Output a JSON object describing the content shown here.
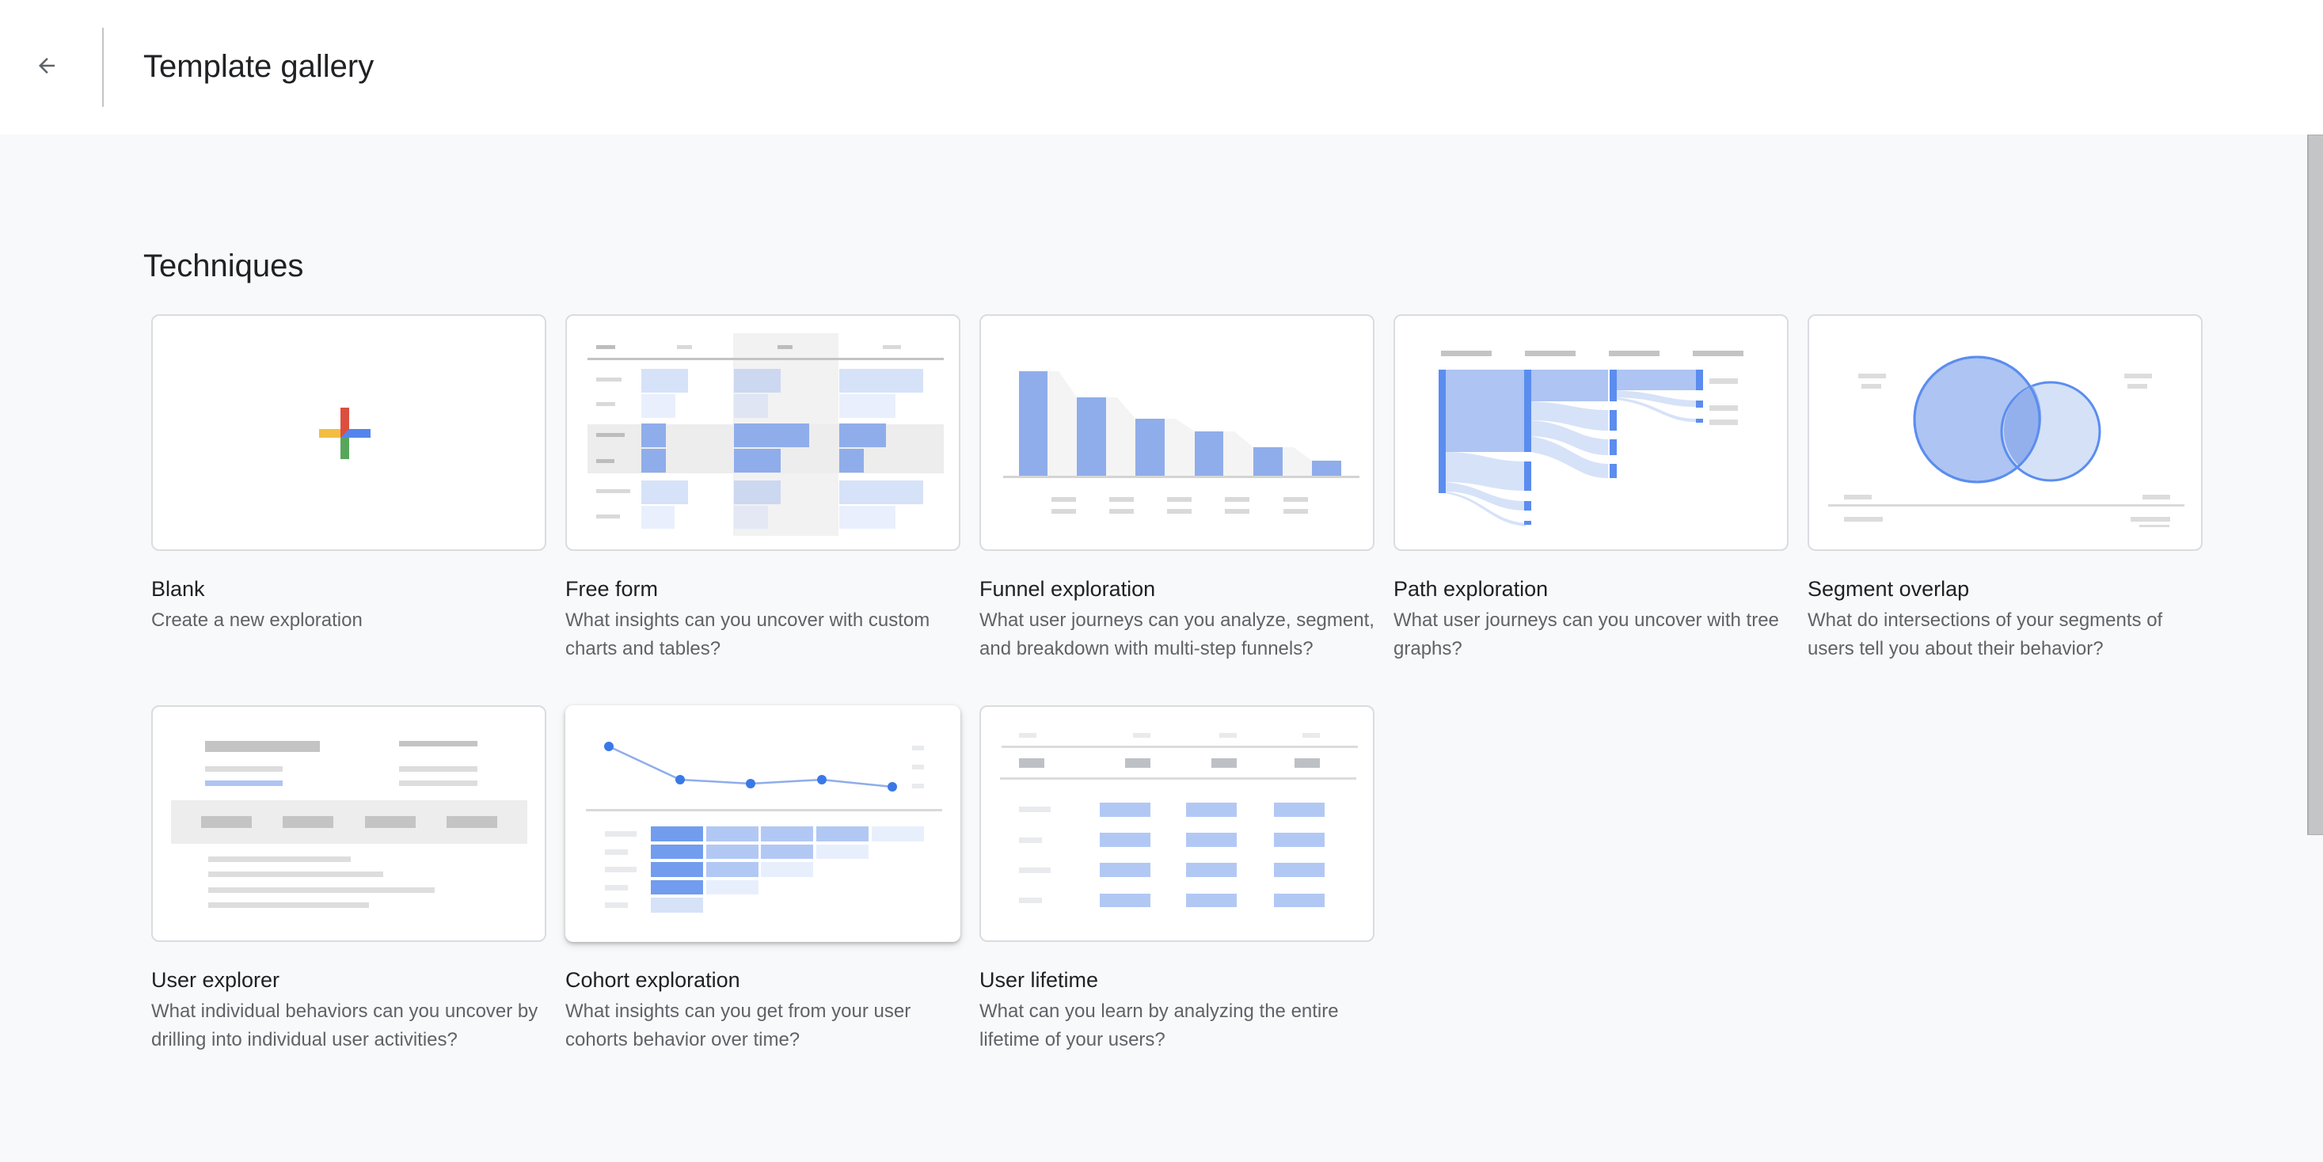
{
  "header": {
    "back_icon": "arrow-left-icon",
    "title": "Template gallery"
  },
  "section": {
    "title": "Techniques"
  },
  "colors": {
    "accent_blue": "#5b8def",
    "bar_blue": "#8fadea",
    "light_blue": "#aec4f2",
    "pale_blue": "#d6e2f8",
    "gray_placeholder": "#c4c4c4",
    "plus_red": "#db4f3f",
    "plus_yellow": "#f1be42",
    "plus_blue": "#5485ec",
    "plus_green": "#58a65c"
  },
  "templates": [
    {
      "id": "blank",
      "title": "Blank",
      "description": "Create a new exploration",
      "thumbnail_icon": "colored-plus-icon"
    },
    {
      "id": "free-form",
      "title": "Free form",
      "description": "What insights can you uncover with custom charts and tables?",
      "thumbnail_icon": "table-chart-thumbnail"
    },
    {
      "id": "funnel",
      "title": "Funnel exploration",
      "description": "What user journeys can you analyze, segment, and breakdown with multi-step funnels?",
      "thumbnail_icon": "funnel-chart-thumbnail"
    },
    {
      "id": "path",
      "title": "Path exploration",
      "description": "What user journeys can you uncover with tree graphs?",
      "thumbnail_icon": "tree-graph-thumbnail"
    },
    {
      "id": "segment-overlap",
      "title": "Segment overlap",
      "description": "What do intersections of your segments of users tell you about their behavior?",
      "thumbnail_icon": "venn-diagram-thumbnail"
    },
    {
      "id": "user-explorer",
      "title": "User explorer",
      "description": "What individual behaviors can you uncover by drilling into individual user activities?",
      "thumbnail_icon": "user-profile-thumbnail"
    },
    {
      "id": "cohort",
      "title": "Cohort exploration",
      "description": "What insights can you get from your user cohorts behavior over time?",
      "thumbnail_icon": "cohort-grid-thumbnail",
      "hovered": true
    },
    {
      "id": "user-lifetime",
      "title": "User lifetime",
      "description": "What can you learn by analyzing the entire lifetime of your users?",
      "thumbnail_icon": "lifetime-table-thumbnail"
    }
  ]
}
